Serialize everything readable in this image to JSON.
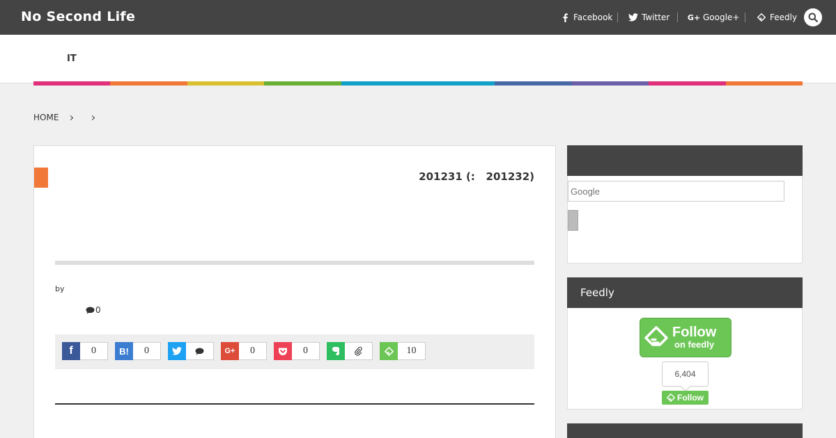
{
  "site": {
    "title": "No Second Life"
  },
  "topnav": [
    {
      "label": "Facebook",
      "icon": "facebook-icon"
    },
    {
      "label": "Twitter",
      "icon": "twitter-icon"
    },
    {
      "label": "Google+",
      "icon": "google-plus-icon"
    },
    {
      "label": "Feedly",
      "icon": "feedly-icon"
    }
  ],
  "header": {
    "category_nav": "IT"
  },
  "category_colors": [
    "#e0307a",
    "#f07838",
    "#d8c030",
    "#6ab035",
    "#10a0c8",
    "#10a0c8",
    "#4a68a8",
    "#6a60a8",
    "#e0307a",
    "#f07838"
  ],
  "breadcrumb": {
    "home": "HOME"
  },
  "article": {
    "date": "201231 (:   201232)",
    "byline": "by",
    "comment_count": "0",
    "share": [
      {
        "name": "facebook",
        "glyph": "f",
        "color": "#3b5998",
        "count": "0"
      },
      {
        "name": "hatena",
        "glyph": "B!",
        "color": "#3c7dd1",
        "count": "0"
      },
      {
        "name": "twitter",
        "glyph": "",
        "color": "#1da1f2",
        "count": ""
      },
      {
        "name": "google-plus",
        "glyph": "G+",
        "color": "#dd4b39",
        "count": "0"
      },
      {
        "name": "pocket",
        "glyph": "",
        "color": "#ee4056",
        "count": "0"
      },
      {
        "name": "evernote",
        "glyph": "",
        "color": "#2dbe60",
        "count": ""
      },
      {
        "name": "feedly",
        "glyph": "",
        "color": "#6cc655",
        "count": "10"
      }
    ]
  },
  "sidebar": {
    "search": {
      "placeholder": "Google"
    },
    "feedly_widget": {
      "title": "Feedly",
      "button_line1": "Follow",
      "button_line2": "on feedly",
      "followers": "6,404",
      "small_button": "Follow"
    }
  }
}
